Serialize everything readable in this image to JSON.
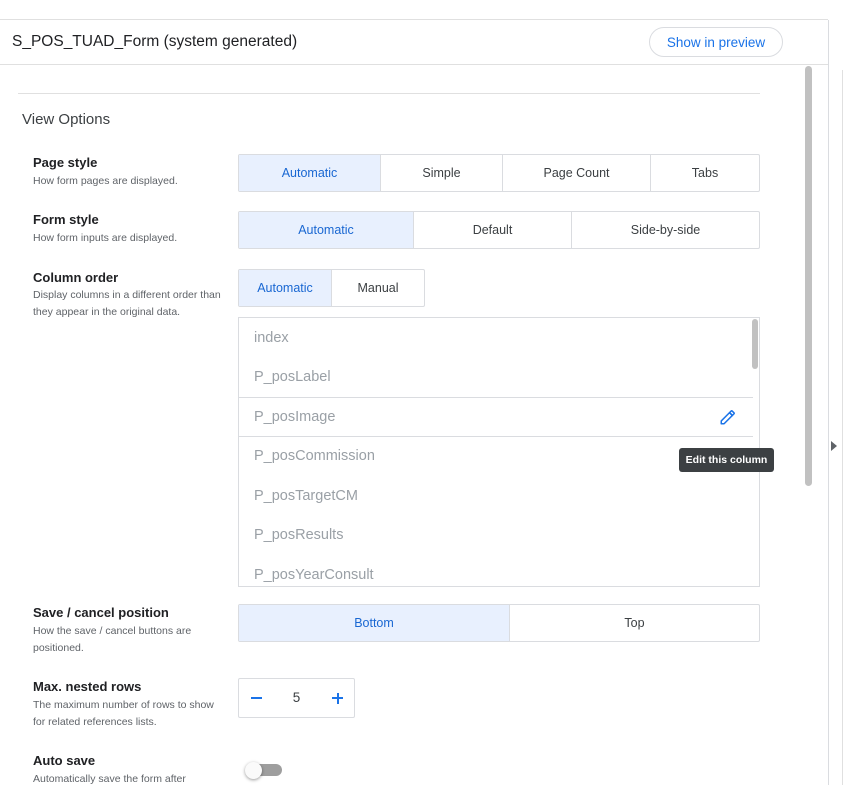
{
  "header": {
    "title": "S_POS_TUAD_Form (system generated)",
    "preview_button": "Show in preview"
  },
  "section_title": "View Options",
  "page_style": {
    "label": "Page style",
    "description": "How form pages are displayed.",
    "options": [
      "Automatic",
      "Simple",
      "Page Count",
      "Tabs"
    ],
    "selected": "Automatic"
  },
  "form_style": {
    "label": "Form style",
    "description": "How form inputs are displayed.",
    "options": [
      "Automatic",
      "Default",
      "Side-by-side"
    ],
    "selected": "Automatic"
  },
  "column_order": {
    "label": "Column order",
    "description": "Display columns in a different order than they appear in the original data.",
    "options": [
      "Automatic",
      "Manual"
    ],
    "selected": "Automatic",
    "columns": [
      "index",
      "P_posLabel",
      "P_posImage",
      "P_posCommission",
      "P_posTargetCM",
      "P_posResults",
      "P_posYearConsult"
    ],
    "hovered_column": "P_posImage",
    "edit_tooltip": "Edit this column",
    "edit_icon": "pencil-icon"
  },
  "save_cancel": {
    "label": "Save / cancel position",
    "description": "How the save / cancel buttons are positioned.",
    "options": [
      "Bottom",
      "Top"
    ],
    "selected": "Bottom"
  },
  "max_nested_rows": {
    "label": "Max. nested rows",
    "description": "The maximum number of rows to show for related references lists.",
    "value": "5",
    "minus_icon": "minus-icon",
    "plus_icon": "plus-icon"
  },
  "auto_save": {
    "label": "Auto save",
    "description": "Automatically save the form after",
    "enabled": false
  },
  "colors": {
    "accent": "#1a73e8",
    "selected_bg": "#e8f0fe",
    "tooltip_bg": "#3c4043"
  }
}
